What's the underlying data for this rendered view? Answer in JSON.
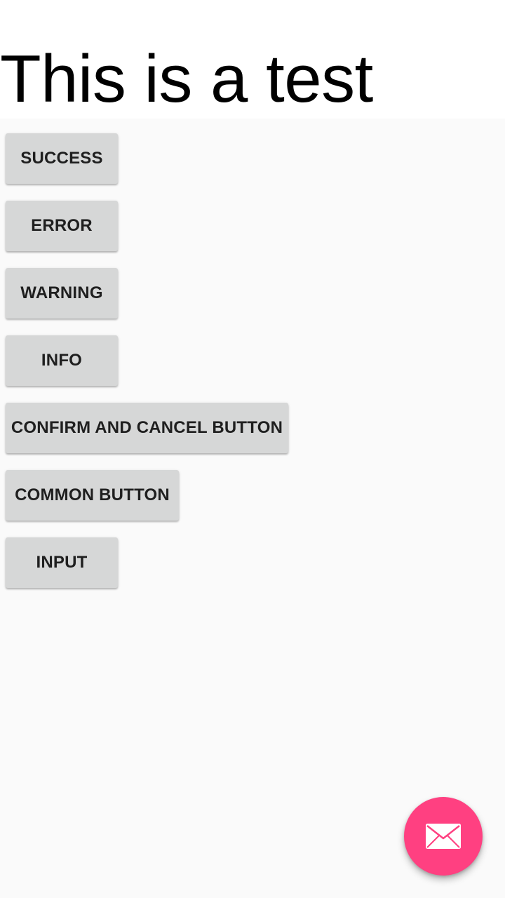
{
  "header": {
    "title": "This is a test"
  },
  "buttons": {
    "success": "SUCCESS",
    "error": "ERROR",
    "warning": "WARNING",
    "info": "INFO",
    "confirm_cancel": "CONFIRM AND CANCEL BUTTON",
    "common": "COMMON BUTTON",
    "input": "INPUT"
  },
  "fab": {
    "icon": "email-icon",
    "color": "#ff4081"
  },
  "colors": {
    "background": "#fafafa",
    "header_background": "#ffffff",
    "button_background": "#d6d7d7",
    "button_text": "#1f1f1f"
  }
}
